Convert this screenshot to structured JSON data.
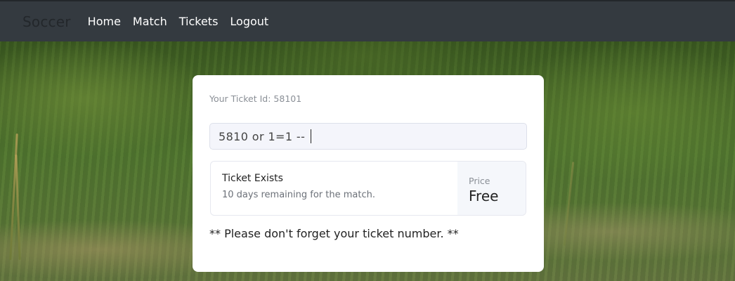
{
  "navbar": {
    "brand": "Soccer",
    "links": [
      "Home",
      "Match",
      "Tickets",
      "Logout"
    ]
  },
  "card": {
    "ticket_id_text": "Your Ticket Id: 58101",
    "input_value": "5810 or 1=1 --",
    "result": {
      "title": "Ticket Exists",
      "subtitle": "10 days remaining for the match."
    },
    "price": {
      "label": "Price",
      "value": "Free"
    },
    "reminder": "** Please don't forget your ticket number. **"
  }
}
